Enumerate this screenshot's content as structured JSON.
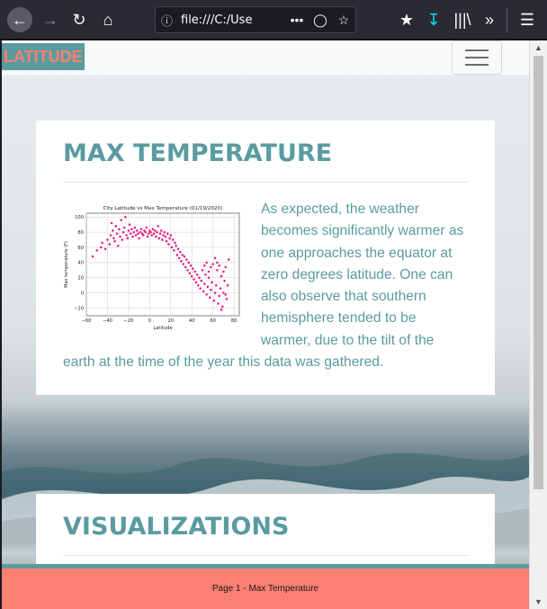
{
  "browser": {
    "url": "file:///C:/Use",
    "icons": [
      "back-arrow-icon",
      "forward-arrow-icon",
      "reload-icon",
      "home-icon",
      "info-icon",
      "more-dots-icon",
      "pocket-icon",
      "bookmark-star-icon",
      "save-to-pocket-icon",
      "download-icon",
      "library-icon",
      "overflow-icon",
      "hamburger-menu-icon"
    ]
  },
  "navbar": {
    "brand": "LATITUDE",
    "colors": {
      "brand_bg": "#5a9ba0",
      "brand_text": "#fa8072"
    }
  },
  "cards": [
    {
      "heading": "MAX TEMPERATURE",
      "text": "As expected, the weather becomes significantly warmer as one approaches the equator at zero degrees latitude. One can also observe that southern hemisphere tended to be warmer, due to the tilt of the earth at the time of the year this data was gathered."
    },
    {
      "heading": "VISUALIZATIONS"
    }
  ],
  "footer": {
    "text": "Page 1 - Max Temperature"
  },
  "chart_data": {
    "type": "scatter",
    "title": "City Latitude vs Max Temperature (01/19/2020)",
    "xlabel": "Latitude",
    "ylabel": "Max temperature (F)",
    "xlim": [
      -60,
      85
    ],
    "ylim": [
      -30,
      105
    ],
    "xticks": [
      -60,
      -40,
      -20,
      0,
      20,
      40,
      60,
      80
    ],
    "yticks": [
      -20,
      0,
      20,
      40,
      60,
      80,
      100
    ],
    "grid": true,
    "color": "#e8177d",
    "points": [
      [
        -54,
        48
      ],
      [
        -50,
        56
      ],
      [
        -46,
        60
      ],
      [
        -45,
        66
      ],
      [
        -42,
        58
      ],
      [
        -40,
        70
      ],
      [
        -38,
        64
      ],
      [
        -37,
        76
      ],
      [
        -36,
        92
      ],
      [
        -35,
        82
      ],
      [
        -34,
        72
      ],
      [
        -33,
        68
      ],
      [
        -32,
        88
      ],
      [
        -31,
        78
      ],
      [
        -30,
        62
      ],
      [
        -29,
        84
      ],
      [
        -28,
        74
      ],
      [
        -27,
        96
      ],
      [
        -26,
        70
      ],
      [
        -25,
        80
      ],
      [
        -24,
        86
      ],
      [
        -23,
        100
      ],
      [
        -22,
        76
      ],
      [
        -21,
        72
      ],
      [
        -20,
        82
      ],
      [
        -19,
        90
      ],
      [
        -18,
        78
      ],
      [
        -17,
        84
      ],
      [
        -16,
        74
      ],
      [
        -15,
        80
      ],
      [
        -14,
        86
      ],
      [
        -13,
        76
      ],
      [
        -12,
        82
      ],
      [
        -11,
        78
      ],
      [
        -10,
        72
      ],
      [
        -9,
        80
      ],
      [
        -8,
        84
      ],
      [
        -7,
        78
      ],
      [
        -6,
        76
      ],
      [
        -5,
        82
      ],
      [
        -4,
        80
      ],
      [
        -3,
        86
      ],
      [
        -2,
        74
      ],
      [
        -1,
        78
      ],
      [
        0,
        82
      ],
      [
        1,
        80
      ],
      [
        2,
        76
      ],
      [
        3,
        84
      ],
      [
        4,
        78
      ],
      [
        5,
        82
      ],
      [
        6,
        74
      ],
      [
        7,
        80
      ],
      [
        8,
        88
      ],
      [
        9,
        72
      ],
      [
        10,
        78
      ],
      [
        11,
        82
      ],
      [
        12,
        70
      ],
      [
        13,
        76
      ],
      [
        14,
        80
      ],
      [
        15,
        74
      ],
      [
        16,
        68
      ],
      [
        17,
        78
      ],
      [
        18,
        64
      ],
      [
        19,
        72
      ],
      [
        20,
        76
      ],
      [
        21,
        60
      ],
      [
        22,
        70
      ],
      [
        23,
        56
      ],
      [
        24,
        66
      ],
      [
        25,
        62
      ],
      [
        26,
        50
      ],
      [
        27,
        58
      ],
      [
        28,
        46
      ],
      [
        29,
        54
      ],
      [
        30,
        42
      ],
      [
        31,
        50
      ],
      [
        32,
        38
      ],
      [
        33,
        48
      ],
      [
        34,
        34
      ],
      [
        35,
        44
      ],
      [
        36,
        30
      ],
      [
        37,
        40
      ],
      [
        38,
        26
      ],
      [
        39,
        36
      ],
      [
        40,
        22
      ],
      [
        41,
        32
      ],
      [
        42,
        18
      ],
      [
        43,
        28
      ],
      [
        44,
        14
      ],
      [
        45,
        24
      ],
      [
        46,
        10
      ],
      [
        47,
        20
      ],
      [
        48,
        6
      ],
      [
        49,
        16
      ],
      [
        50,
        30
      ],
      [
        51,
        2
      ],
      [
        52,
        12
      ],
      [
        53,
        24
      ],
      [
        54,
        -2
      ],
      [
        55,
        8
      ],
      [
        56,
        20
      ],
      [
        57,
        -6
      ],
      [
        58,
        4
      ],
      [
        59,
        14
      ],
      [
        60,
        38
      ],
      [
        61,
        -10
      ],
      [
        62,
        0
      ],
      [
        63,
        10
      ],
      [
        64,
        30
      ],
      [
        65,
        -14
      ],
      [
        66,
        -4
      ],
      [
        67,
        6
      ],
      [
        68,
        22
      ],
      [
        69,
        -18
      ],
      [
        70,
        0
      ],
      [
        71,
        16
      ],
      [
        72,
        34
      ],
      [
        73,
        -8
      ],
      [
        74,
        10
      ],
      [
        75,
        44
      ],
      [
        62,
        46
      ],
      [
        64,
        40
      ],
      [
        66,
        36
      ],
      [
        58,
        34
      ],
      [
        56,
        28
      ],
      [
        70,
        28
      ],
      [
        68,
        -22
      ],
      [
        72,
        -2
      ],
      [
        54,
        40
      ],
      [
        52,
        36
      ]
    ]
  }
}
